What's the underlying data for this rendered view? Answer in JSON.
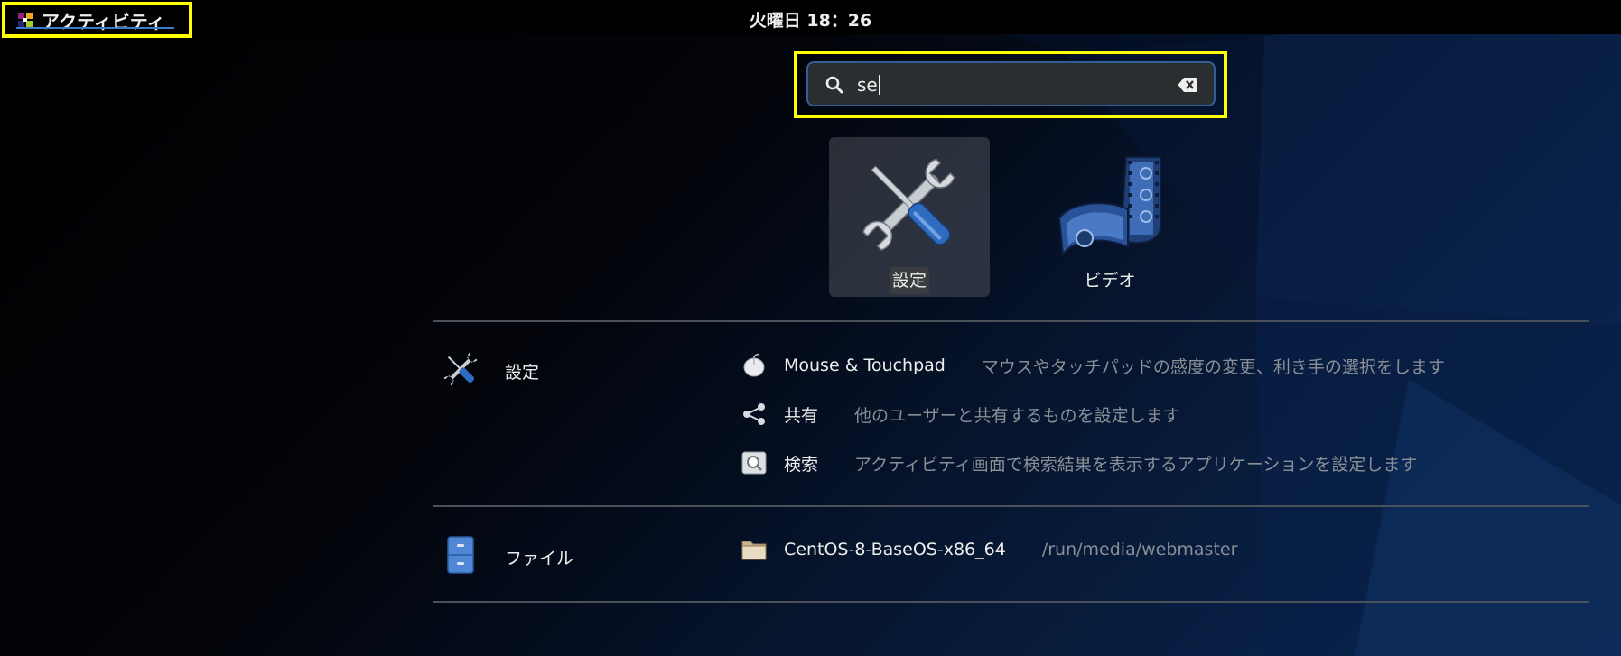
{
  "topbar": {
    "activities_label": "アクティビティ",
    "clock": "火曜日 18：26"
  },
  "search": {
    "value": "se"
  },
  "apps": [
    {
      "label": "設定",
      "icon": "settings-tools-icon",
      "selected": true
    },
    {
      "label": "ビデオ",
      "icon": "video-film-icon",
      "selected": false
    }
  ],
  "providers": {
    "settings": {
      "name": "設定",
      "icon": "settings-tools-icon",
      "results": [
        {
          "icon": "mouse-icon",
          "title": "Mouse & Touchpad",
          "description": "マウスやタッチパッドの感度の変更、利き手の選択をします"
        },
        {
          "icon": "share-icon",
          "title": "共有",
          "description": "他のユーザーと共有するものを設定します"
        },
        {
          "icon": "search-settings-icon",
          "title": "検索",
          "description": "アクティビティ画面で検索結果を表示するアプリケーションを設定します"
        }
      ]
    },
    "files": {
      "name": "ファイル",
      "icon": "file-cabinet-icon",
      "results": [
        {
          "icon": "folder-icon",
          "title": "CentOS-8-BaseOS-x86_64",
          "description": "/run/media/webmaster"
        }
      ]
    }
  },
  "colors": {
    "highlight": "#ffff00",
    "accent": "#3f7ac9"
  }
}
